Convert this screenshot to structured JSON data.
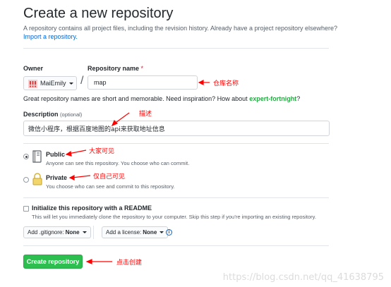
{
  "header": {
    "title": "Create a new repository",
    "subtitle": "A repository contains all project files, including the revision history. Already have a project repository elsewhere?",
    "import_link": "Import a repository."
  },
  "owner": {
    "label": "Owner",
    "value": "MaiEmily"
  },
  "repo_name": {
    "label": "Repository name",
    "required_mark": "*",
    "value": "map"
  },
  "separator": "/",
  "name_hint": {
    "text": "Great repository names are short and memorable. Need inspiration? How about",
    "suggestion": "expert-fortnight",
    "end": "?"
  },
  "description": {
    "label": "Description",
    "optional": "(optional)",
    "value": "微信小程序，根据百度地图的api来获取地址信息"
  },
  "visibility": {
    "public": {
      "title": "Public",
      "desc": "Anyone can see this repository. You choose who can commit.",
      "checked": true
    },
    "private": {
      "title": "Private",
      "desc": "You choose who can see and commit to this repository.",
      "checked": false
    }
  },
  "init_readme": {
    "label": "Initialize this repository with a README",
    "desc": "This will let you immediately clone the repository to your computer. Skip this step if you’re importing an existing repository.",
    "checked": false
  },
  "gitignore": {
    "label": "Add .gitignore:",
    "value": "None"
  },
  "license": {
    "label": "Add a license:",
    "value": "None"
  },
  "info_icon": "i",
  "create_button": "Create repository",
  "annotations": {
    "repo_name": "仓库名称",
    "description": "描述",
    "public": "大家可见",
    "private": "仅自己可见",
    "create": "点击创建"
  },
  "watermark": "https://blog.csdn.net/qq_41638795",
  "colors": {
    "accent_green": "#2cbe4e",
    "link_blue": "#0366d6",
    "annotation_red": "#ff0000"
  }
}
